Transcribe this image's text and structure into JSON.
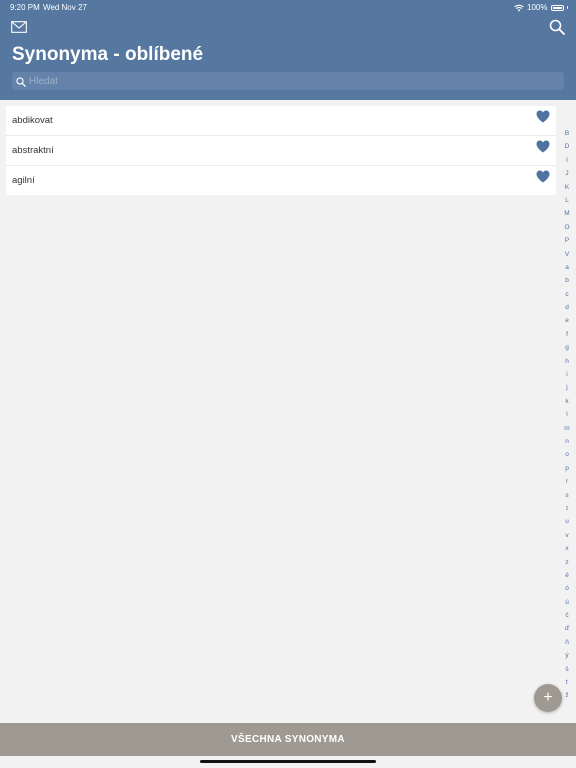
{
  "status_bar": {
    "time": "9:20 PM",
    "date": "Wed Nov 27",
    "battery": "100%",
    "battery_level": 1.0
  },
  "header": {
    "title": "Synonyma - oblíbené",
    "mail_icon": "mail-icon",
    "search_icon": "search-icon",
    "background_color": "#5577a0"
  },
  "search": {
    "placeholder": "Hledat",
    "value": ""
  },
  "list": {
    "items": [
      {
        "label": "abdikovat",
        "favorite": true
      },
      {
        "label": "abstraktní",
        "favorite": true
      },
      {
        "label": "agilní",
        "favorite": true
      }
    ],
    "heart_color": "#4f72a0"
  },
  "index_letters": [
    "B",
    "D",
    "I",
    "J",
    "K",
    "L",
    "M",
    "O",
    "P",
    "V",
    "a",
    "b",
    "c",
    "d",
    "e",
    "f",
    "g",
    "h",
    "i",
    "j",
    "k",
    "l",
    "m",
    "n",
    "o",
    "p",
    "r",
    "s",
    "t",
    "u",
    "v",
    "x",
    "z",
    "é",
    "ó",
    "ú",
    "č",
    "ď",
    "ň",
    "ý",
    "š",
    "ť",
    "ž"
  ],
  "fab": {
    "label": "+"
  },
  "bottom_button": {
    "label": "VŠECHNA SYNONYMA",
    "color": "#9e9a92"
  }
}
